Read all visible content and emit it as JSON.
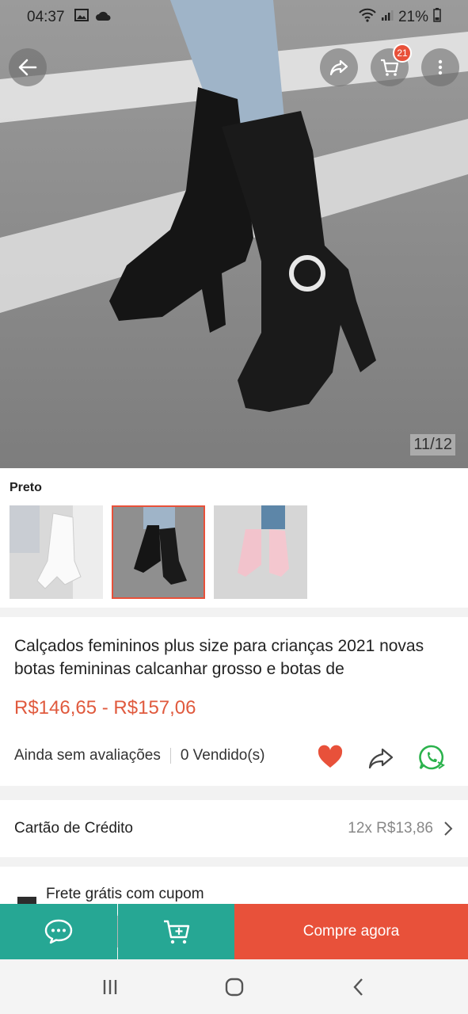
{
  "status_bar": {
    "time": "04:37",
    "battery": "21%",
    "icons": [
      "gallery-icon",
      "cloud-icon",
      "wifi-icon",
      "signal-icon",
      "battery-icon"
    ]
  },
  "header": {
    "back_icon": "arrow-left-icon",
    "share_icon": "share-icon",
    "cart_icon": "cart-icon",
    "cart_count": "21",
    "more_icon": "more-vertical-icon"
  },
  "gallery": {
    "counter": "11/12"
  },
  "variants": {
    "label": "Preto",
    "options": [
      {
        "color": "white",
        "selected": false
      },
      {
        "color": "black",
        "selected": true
      },
      {
        "color": "pink",
        "selected": false
      }
    ]
  },
  "product": {
    "title": "Calçados femininos plus size para crianças 2021 novas botas femininas calcanhar grosso e botas de",
    "price": "R$146,65 - R$157,06",
    "reviews": "Ainda sem avaliações",
    "sold": "0 Vendido(s)"
  },
  "actions": {
    "favorite_icon": "heart-icon",
    "share_icon": "share-icon",
    "whatsapp_icon": "whatsapp-icon"
  },
  "payment": {
    "label": "Cartão de Crédito",
    "value": "12x R$13,86"
  },
  "shipping": {
    "label": "Frete grátis com cupom"
  },
  "bottom_bar": {
    "chat_icon": "chat-icon",
    "add_cart_icon": "add-to-cart-icon",
    "buy_label": "Compre agora"
  },
  "colors": {
    "accent": "#e8513a",
    "price": "#e05a3e",
    "teal": "#26a794"
  }
}
